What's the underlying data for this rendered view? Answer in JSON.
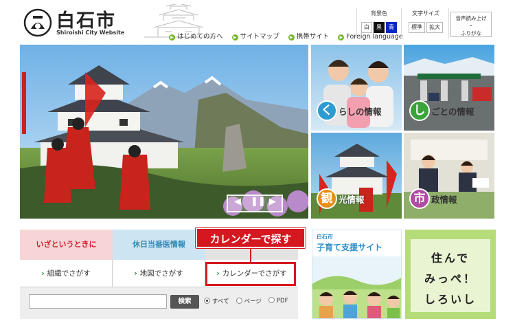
{
  "header": {
    "logo_title": "白石市",
    "logo_subtitle": "Shiroishi City Website",
    "nav_links": [
      {
        "label": "はじめての方へ"
      },
      {
        "label": "サイトマップ"
      },
      {
        "label": "携帯サイト"
      },
      {
        "label": "Foreign language"
      }
    ],
    "bg_color": {
      "label": "背景色",
      "options": [
        "白",
        "黒",
        "青"
      ]
    },
    "font_size": {
      "label": "文字サイズ",
      "options": [
        "標準",
        "拡大"
      ]
    },
    "voice": {
      "line1": "音声読み上げ",
      "line2": "・",
      "line3": "ふりがな"
    }
  },
  "tiles": [
    {
      "circle": "く",
      "text": "らしの情報",
      "circle_color": "#2e9bd0",
      "dark": true
    },
    {
      "circle": "し",
      "text": "ごとの情報",
      "circle_color": "#3aa43a",
      "dark": true
    },
    {
      "circle": "観",
      "text": "光情報",
      "circle_color": "#e88d1a",
      "dark": false
    },
    {
      "circle": "市",
      "text": "政情報",
      "circle_color": "#b04ca4",
      "dark": true
    }
  ],
  "tabs": {
    "emergency": "いざというときに",
    "doctor": "休日当番医情報"
  },
  "search_buttons": [
    {
      "label": "組織でさがす"
    },
    {
      "label": "地図でさがす"
    },
    {
      "label": "カレンダーでさがす"
    }
  ],
  "callout": "カレンダーで探す",
  "search": {
    "value": "",
    "button": "検索",
    "options": [
      "すべて",
      "ページ",
      "PDF"
    ],
    "selected": "すべて"
  },
  "banners": {
    "kosodate_city": "白石市",
    "kosodate_title": "子育て支援サイト",
    "sumu_lines": [
      "住んで",
      "みっぺ！",
      "しろいし"
    ]
  },
  "colors": {
    "accent_red": "#d51820",
    "nav_green": "#76b82a"
  }
}
